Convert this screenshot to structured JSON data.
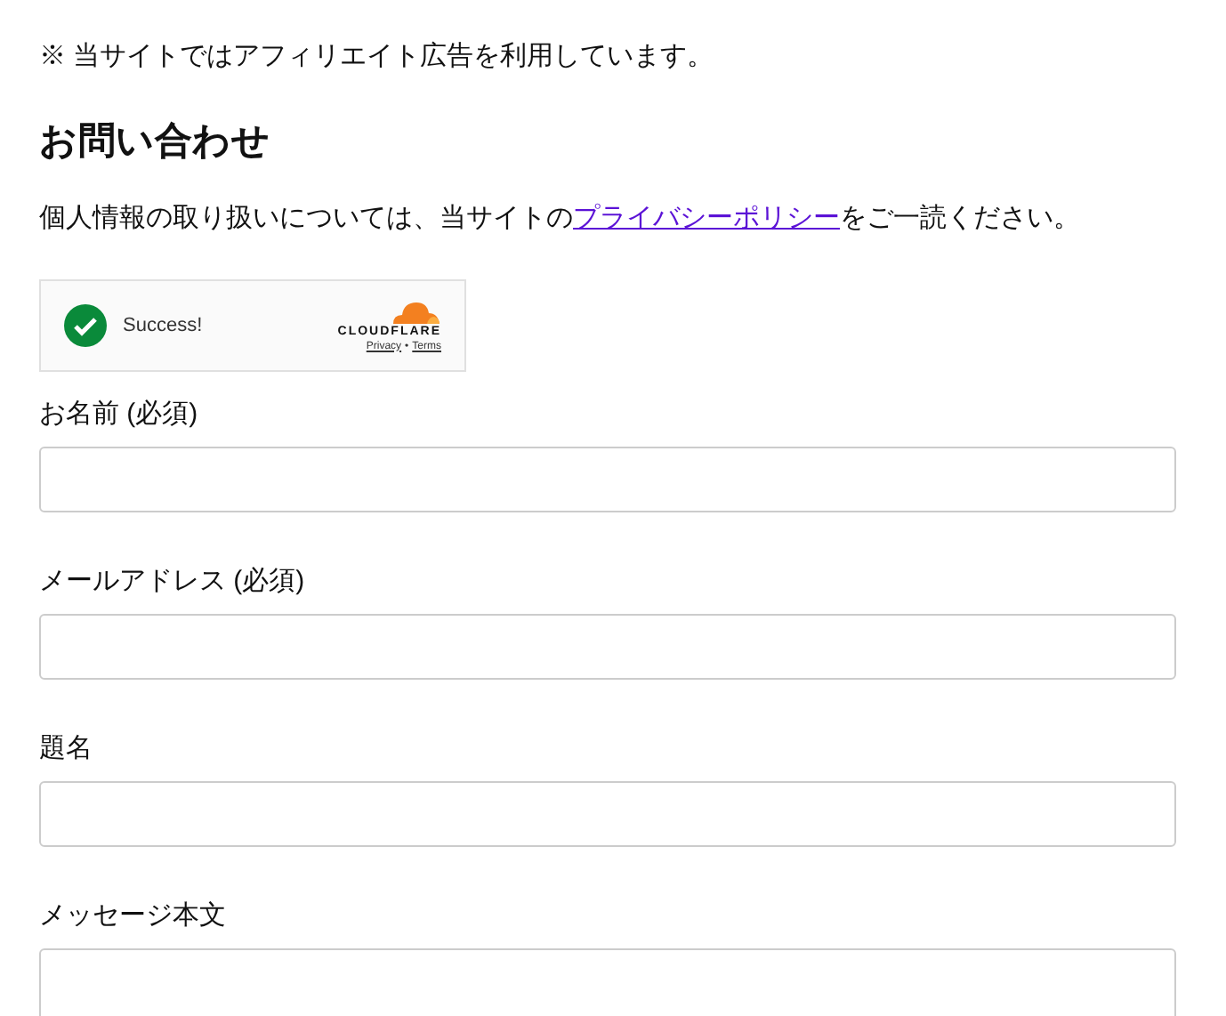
{
  "notice": "※ 当サイトではアフィリエイト広告を利用しています。",
  "heading": "お問い合わせ",
  "privacy": {
    "before": "個人情報の取り扱いについては、当サイトの",
    "link": "プライバシーポリシー",
    "after": "をご一読ください。"
  },
  "captcha": {
    "status": "Success!",
    "brand": "CLOUDFLARE",
    "links": [
      "Privacy",
      "Terms"
    ],
    "separator": "•"
  },
  "fields": [
    {
      "label": "お名前 (必須)",
      "kind": "input"
    },
    {
      "label": "メールアドレス (必須)",
      "kind": "input"
    },
    {
      "label": "題名",
      "kind": "input"
    },
    {
      "label": "メッセージ本文",
      "kind": "textarea"
    }
  ]
}
